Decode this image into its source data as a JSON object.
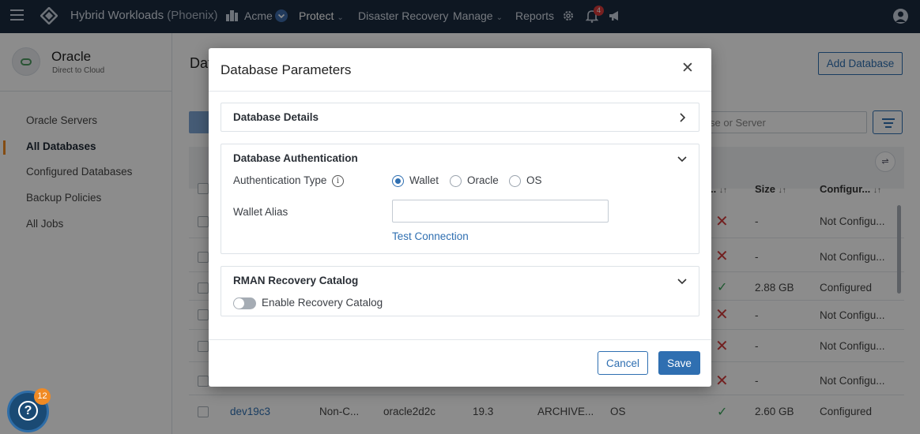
{
  "topbar": {
    "product": "Hybrid Workloads",
    "region": "(Phoenix)",
    "tenant": "Acme",
    "nav": [
      "Protect",
      "Disaster Recovery",
      "Manage",
      "Reports"
    ],
    "notification_count": "4"
  },
  "sidebar": {
    "title": "Oracle",
    "subtitle": "Direct to Cloud",
    "items": [
      "Oracle Servers",
      "All Databases",
      "Configured Databases",
      "Backup Policies",
      "All Jobs"
    ],
    "active_index": 1
  },
  "main": {
    "page_title": "Dat",
    "add_button": "Add Database",
    "search_placeholder": "se or Server",
    "columns": [
      ".. ",
      "Size",
      "Configur..."
    ],
    "rows": [
      {
        "status": "x",
        "size": "-",
        "configured": "Not Configu..."
      },
      {
        "status": "x",
        "size": "-",
        "configured": "Not Configu..."
      },
      {
        "status": "check",
        "size": "2.88 GB",
        "configured": "Configured"
      },
      {
        "status": "x",
        "size": "-",
        "configured": "Not Configu..."
      },
      {
        "status": "x",
        "size": "-",
        "configured": "Not Configu..."
      },
      {
        "status": "x",
        "size": "-",
        "configured": "Not Configu..."
      }
    ],
    "last_row": {
      "name": "dev19c3",
      "type": "Non-C...",
      "server": "oracle2d2c",
      "version": "19.3",
      "mode": "ARCHIVE...",
      "os": "OS",
      "size": "2.60 GB",
      "configured": "Configured"
    }
  },
  "help": {
    "badge": "12"
  },
  "modal": {
    "title": "Database Parameters",
    "sections": {
      "details": {
        "title": "Database Details"
      },
      "auth": {
        "title": "Database Authentication",
        "auth_type_label": "Authentication Type",
        "options": [
          "Wallet",
          "Oracle",
          "OS"
        ],
        "selected": "Wallet",
        "wallet_alias_label": "Wallet Alias",
        "wallet_alias_value": "",
        "test_connection": "Test Connection"
      },
      "rman": {
        "title": "RMAN Recovery Catalog",
        "toggle_label": "Enable Recovery Catalog",
        "toggle_on": false
      }
    },
    "cancel": "Cancel",
    "save": "Save"
  },
  "colors": {
    "nav_bg": "#1b2a3e",
    "accent": "#2f6fb1",
    "active_marker": "#f08a24",
    "error": "#d43c3c",
    "success": "#3aa55a"
  }
}
